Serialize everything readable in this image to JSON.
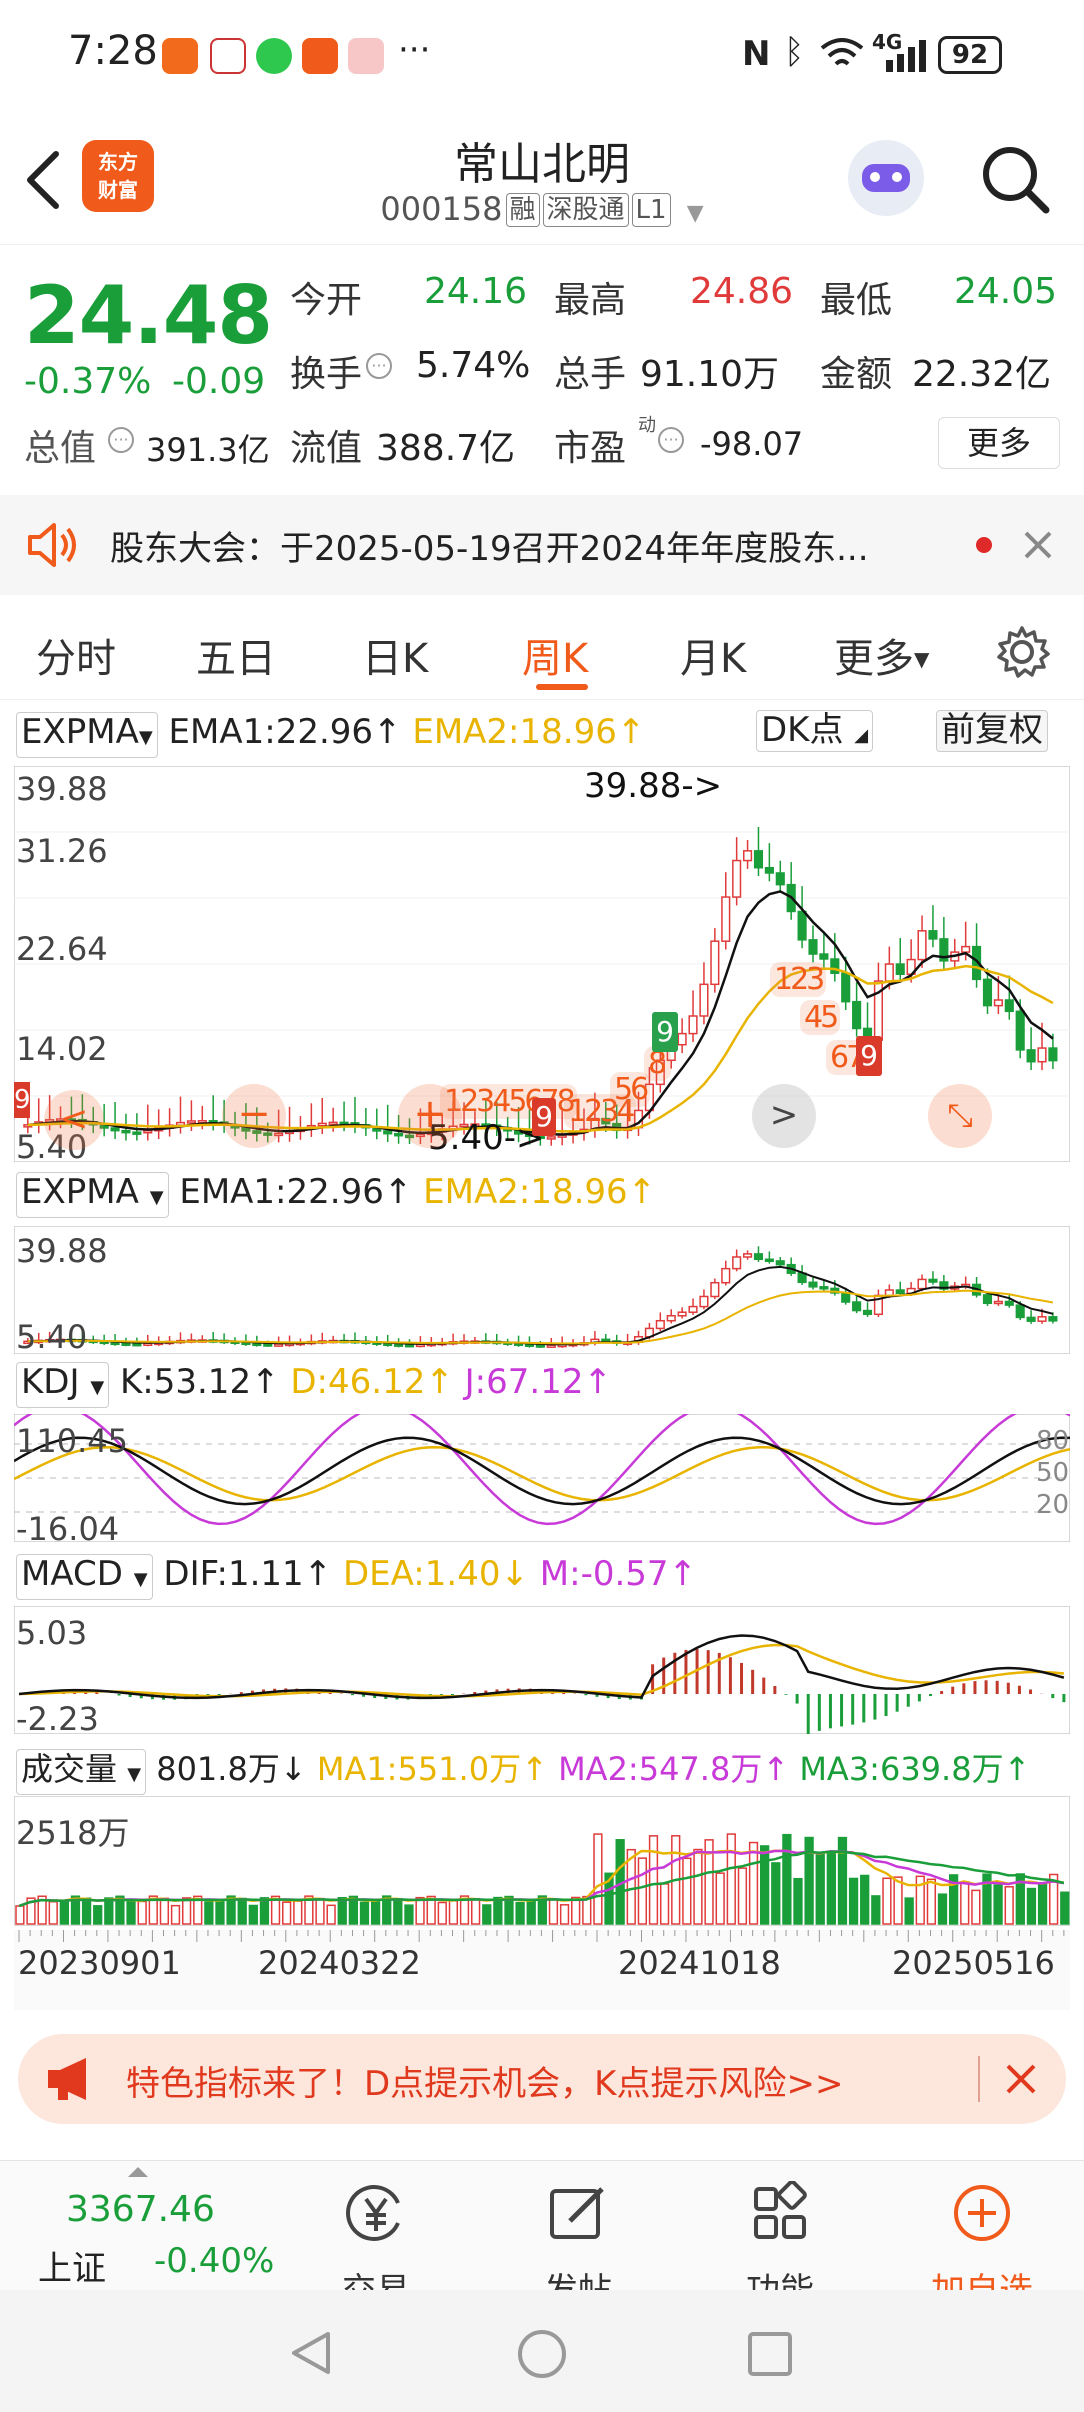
{
  "status_bar": {
    "time": "7:28",
    "dots": "···",
    "battery": "92",
    "network": "4G"
  },
  "header": {
    "logo_line1": "东方",
    "logo_line2": "财富",
    "stock_name": "常山北明",
    "stock_code": "000158",
    "tags": [
      "融",
      "深股通",
      "L1"
    ]
  },
  "quote": {
    "price": "24.48",
    "change_pct": "-0.37%",
    "change_abs": "-0.09",
    "open_label": "今开",
    "open": "24.16",
    "high_label": "最高",
    "high": "24.86",
    "low_label": "最低",
    "low": "24.05",
    "turnover_label": "换手",
    "turnover": "5.74%",
    "volume_label": "总手",
    "volume": "91.10万",
    "amount_label": "金额",
    "amount": "22.32亿",
    "mcap_label": "总值",
    "mcap": "391.3亿",
    "float_label": "流值",
    "float_cap": "388.7亿",
    "pe_label": "市盈",
    "pe_sup": "动",
    "pe": "-98.07",
    "more": "更多"
  },
  "notice": {
    "text": "股东大会：于2025-05-19召开2024年年度股东..."
  },
  "tabs": [
    "分时",
    "五日",
    "日K",
    "周K",
    "月K",
    "更多"
  ],
  "active_tab": "周K",
  "main_chart": {
    "indicator": "EXPMA",
    "ema1": "EMA1:22.96↑",
    "ema2": "EMA2:18.96↑",
    "dk_btn": "DK点",
    "adjust_btn": "前复权",
    "y_labels": [
      "39.88",
      "31.26",
      "22.64",
      "14.02",
      "5.40"
    ],
    "max_marker": "39.88->",
    "min_marker": "5.40->",
    "seq_up1": "12345678",
    "seq_up2": "1234",
    "seq_up3": "56",
    "seq_up4": "8",
    "seq_down1": "123",
    "seq_down2": "45",
    "seq_down3": "678",
    "badge9": "9"
  },
  "mini_chart": {
    "indicator": "EXPMA",
    "ema1": "EMA1:22.96↑",
    "ema2": "EMA2:18.96↑",
    "y_labels": [
      "39.88",
      "5.40"
    ]
  },
  "kdj": {
    "indicator": "KDJ",
    "k": "K:53.12↑",
    "d": "D:46.12↑",
    "j": "J:67.12↑",
    "y_labels": [
      "110.45",
      "-16.04"
    ],
    "right_labels": [
      "80",
      "50",
      "20"
    ]
  },
  "macd": {
    "indicator": "MACD",
    "dif": "DIF:1.11↑",
    "dea": "DEA:1.40↓",
    "m": "M:-0.57↑",
    "y_labels": [
      "5.03",
      "-2.23"
    ]
  },
  "volume": {
    "indicator": "成交量",
    "value": "801.8万↓",
    "ma1": "MA1:551.0万↑",
    "ma2": "MA2:547.8万↑",
    "ma3": "MA3:639.8万↑",
    "y_label": "2518万"
  },
  "dates": [
    "20230901",
    "20240322",
    "20241018",
    "20250516"
  ],
  "banner": {
    "text": "特色指标来了！D点提示机会，K点提示风险>>"
  },
  "bottom_nav": {
    "index_value": "3367.46",
    "index_name": "上证",
    "index_change": "-0.40%",
    "items": [
      "交易",
      "发帖",
      "功能",
      "加自选"
    ]
  },
  "colors": {
    "up": "#e03a3a",
    "down": "#1a9e3a",
    "accent": "#f05a1a",
    "ema2": "#e8b400",
    "j_line": "#c83ad8"
  }
}
